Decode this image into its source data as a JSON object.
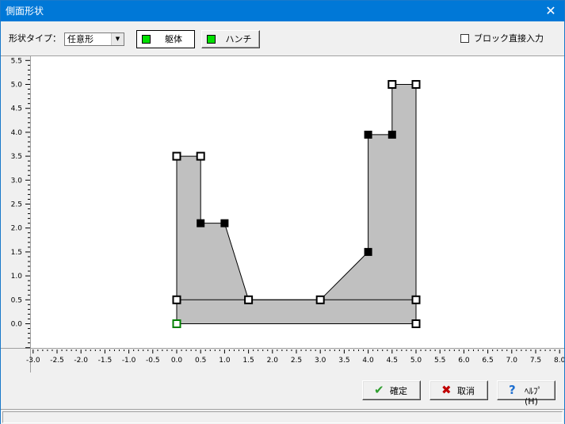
{
  "window": {
    "title": "側面形状",
    "close_glyph": "✕"
  },
  "toolbar": {
    "shape_type_label": "形状タイプ：",
    "shape_type_value": "任意形",
    "body_button": "躯体",
    "haunch_button": "ハンチ",
    "block_input_label": "ブロック直接入力",
    "block_input_checked": false
  },
  "plot": {
    "x_ticks": [
      "-3.0",
      "-2.5",
      "-2.0",
      "-1.5",
      "-1.0",
      "-0.5",
      "0.0",
      "0.5",
      "1.0",
      "1.5",
      "2.0",
      "2.5",
      "3.0",
      "3.5",
      "4.0",
      "4.5",
      "5.0",
      "5.5",
      "6.0",
      "6.5",
      "7.0",
      "7.5",
      "8.0"
    ],
    "y_ticks": [
      "0.0",
      "0.5",
      "1.0",
      "1.5",
      "2.0",
      "2.5",
      "3.0",
      "3.5",
      "4.0",
      "4.5",
      "5.0",
      "5.5"
    ],
    "xlim": [
      -3.0,
      8.0
    ],
    "ylim": [
      -0.5,
      5.5
    ],
    "fill_color": "#c0c0c0",
    "origin_marker_color": "#008000",
    "polygon": [
      [
        0,
        0
      ],
      [
        5,
        0
      ],
      [
        5,
        5
      ],
      [
        4.5,
        5
      ],
      [
        4.5,
        3.95
      ],
      [
        4,
        3.95
      ],
      [
        4,
        1.5
      ],
      [
        3,
        0.5
      ],
      [
        1.5,
        0.5
      ],
      [
        1,
        2.1
      ],
      [
        0.5,
        2.1
      ],
      [
        0.5,
        3.5
      ],
      [
        0,
        3.5
      ]
    ],
    "divider_line": [
      [
        0,
        0.5
      ],
      [
        5,
        0.5
      ]
    ],
    "open_markers": [
      [
        0,
        3.5
      ],
      [
        0.5,
        3.5
      ],
      [
        0,
        0.5
      ],
      [
        1.5,
        0.5
      ],
      [
        3,
        0.5
      ],
      [
        5,
        0.5
      ],
      [
        5,
        0
      ],
      [
        4.5,
        5
      ],
      [
        5,
        5
      ]
    ],
    "filled_markers": [
      [
        0.5,
        2.1
      ],
      [
        1,
        2.1
      ],
      [
        4,
        1.5
      ],
      [
        4,
        3.95
      ],
      [
        4.5,
        3.95
      ]
    ],
    "origin_marker": [
      0,
      0
    ]
  },
  "buttons": {
    "ok": "確定",
    "cancel": "取消",
    "help": "ﾍﾙﾌﾟ(H)"
  }
}
